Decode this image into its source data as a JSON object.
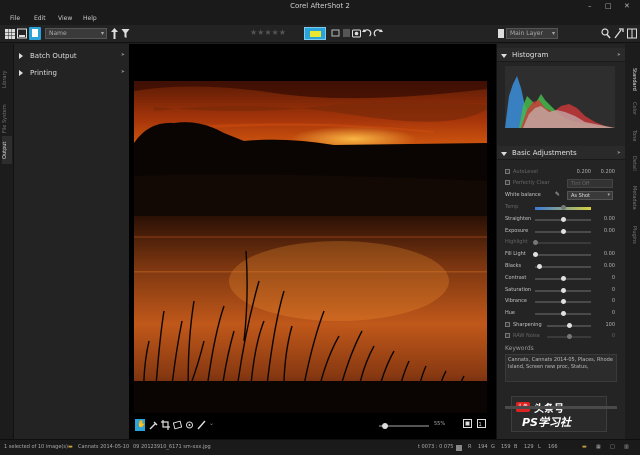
{
  "window": {
    "title": "Corel AfterShot 2",
    "buttons": [
      "–",
      "□",
      "✕"
    ]
  },
  "menu": [
    "File",
    "Edit",
    "View",
    "Help"
  ],
  "toolbar": {
    "name_dropdown": "Name",
    "layer_dropdown": "Main Layer",
    "stars": [
      "★",
      "★",
      "★",
      "★",
      "★"
    ]
  },
  "left_tabs": [
    "Library",
    "File System",
    "Output"
  ],
  "left_panel": {
    "items": [
      {
        "label": "Batch Output"
      },
      {
        "label": "Printing"
      }
    ]
  },
  "right_tabs": [
    "Standard",
    "Color",
    "Tone",
    "Detail",
    "Metadata",
    "Plugins"
  ],
  "histogram": {
    "title": "Histogram"
  },
  "basic_adjustments": {
    "title": "Basic Adjustments",
    "autolevel": {
      "label": "AutoLevel",
      "v1": "0.200",
      "v2": "0.200"
    },
    "perfectly_clear": {
      "label": "Perfectly Clear",
      "value": "Tint Off"
    },
    "white_balance": {
      "label": "White balance",
      "value": "As Shot"
    },
    "sliders": [
      {
        "label": "Temp",
        "value": "",
        "pos": 0.5,
        "dim": true
      },
      {
        "label": "Straighten",
        "value": "0.00",
        "pos": 0.5,
        "dim": false
      },
      {
        "label": "Exposure",
        "value": "0.00",
        "pos": 0.5,
        "dim": false
      },
      {
        "label": "Highlight",
        "value": "",
        "pos": 0.0,
        "dim": true
      },
      {
        "label": "Fill Light",
        "value": "0.00",
        "pos": 0.0,
        "dim": false
      },
      {
        "label": "Blacks",
        "value": "0.00",
        "pos": 0.08,
        "dim": false
      },
      {
        "label": "Contrast",
        "value": "0",
        "pos": 0.5,
        "dim": false
      },
      {
        "label": "Saturation",
        "value": "0",
        "pos": 0.5,
        "dim": false
      },
      {
        "label": "Vibrance",
        "value": "0",
        "pos": 0.5,
        "dim": false
      },
      {
        "label": "Hue",
        "value": "0",
        "pos": 0.5,
        "dim": false
      }
    ],
    "sharpening": {
      "label": "Sharpening",
      "value": "100"
    },
    "raw_noise": {
      "label": "RAW Noise",
      "value": "0"
    }
  },
  "keywords": {
    "title": "Keywords",
    "text": "Cannats, Cannats 2014-05, Places, Rhode Island, Screen new proc, Status,"
  },
  "viewer": {
    "zoom": "55%"
  },
  "status": {
    "selection": "1 selected of 10 image(s)",
    "folder": "Cannats 2014-05-10",
    "filename": "09 20123910_6171 sm-xxx.jpg",
    "coords": "t 0073 : 0 075",
    "r_label": "R",
    "r": "194",
    "g_label": "G",
    "g": "159",
    "b_label": "B",
    "b": "129",
    "l_label": "L",
    "l": "166"
  },
  "watermark": {
    "line1": "头条号",
    "line2": "PS学习社"
  },
  "colors": {
    "accent": "#2aa3d8",
    "sky_top": "#3a1408",
    "sky_mid": "#e06510",
    "sun": "#ffb020"
  }
}
